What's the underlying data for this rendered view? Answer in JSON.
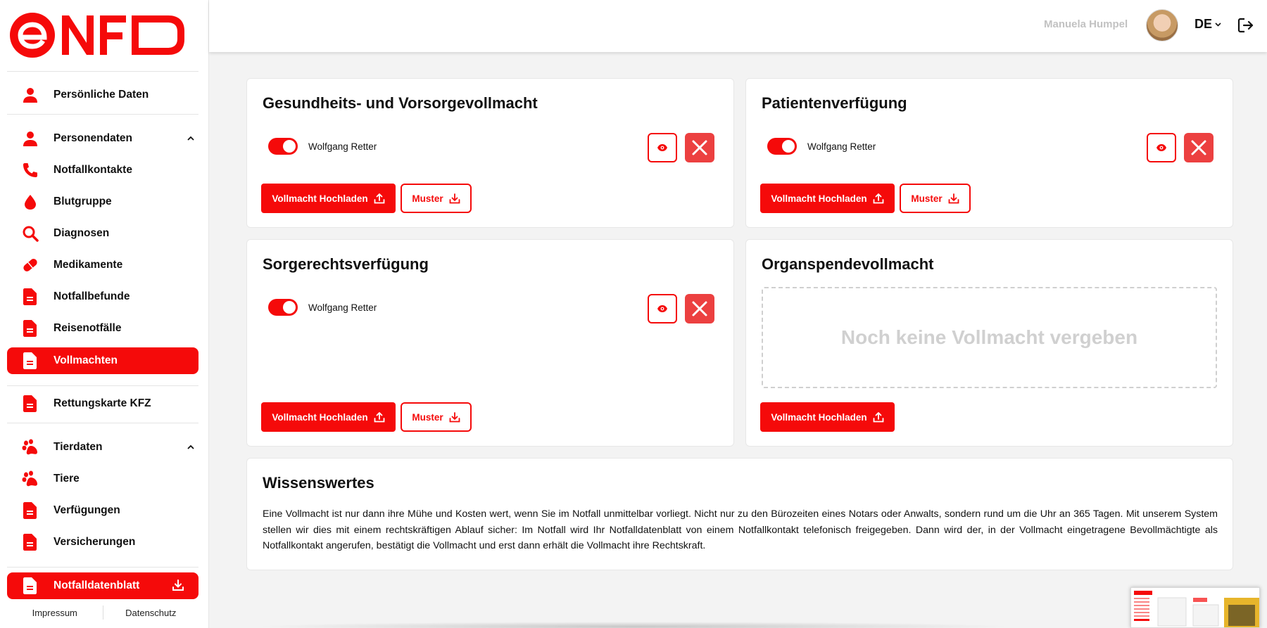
{
  "brand": {
    "logo_text": "eNFD",
    "accent": "#f50a0a",
    "danger": "#ec4040"
  },
  "sidebar": {
    "items": [
      {
        "label": "Persönliche Daten",
        "icon": "person-icon"
      },
      {
        "label": "Personendaten",
        "icon": "person-icon",
        "expanded": true
      },
      {
        "label": "Notfallkontakte",
        "icon": "phone-icon"
      },
      {
        "label": "Blutgruppe",
        "icon": "blood-drop-icon"
      },
      {
        "label": "Diagnosen",
        "icon": "search-icon"
      },
      {
        "label": "Medikamente",
        "icon": "pill-icon"
      },
      {
        "label": "Notfallbefunde",
        "icon": "document-icon"
      },
      {
        "label": "Reisenotfälle",
        "icon": "document-icon"
      },
      {
        "label": "Vollmachten",
        "icon": "document-icon",
        "active": true
      },
      {
        "label": "Rettungskarte KFZ",
        "icon": "document-icon"
      },
      {
        "label": "Tierdaten",
        "icon": "paw-icon",
        "expanded": true
      },
      {
        "label": "Tiere",
        "icon": "paw-icon"
      },
      {
        "label": "Verfügungen",
        "icon": "document-icon"
      },
      {
        "label": "Versicherungen",
        "icon": "document-icon"
      },
      {
        "label": "Notfalldatenblatt",
        "icon": "document-icon",
        "active": true,
        "trailing_icon": "download-icon"
      }
    ],
    "footer": {
      "impressum": "Impressum",
      "datenschutz": "Datenschutz"
    }
  },
  "header": {
    "user_name": "Manuela Humpel",
    "language": "DE"
  },
  "cards": [
    {
      "title": "Gesundheits- und Vorsorgevollmacht",
      "person": "Wolfgang Retter",
      "toggle_on": true,
      "upload_label": "Vollmacht Hochladen",
      "muster_label": "Muster"
    },
    {
      "title": "Patientenverfügung",
      "person": "Wolfgang Retter",
      "toggle_on": true,
      "upload_label": "Vollmacht Hochladen",
      "muster_label": "Muster"
    },
    {
      "title": "Sorgerechtsverfügung",
      "person": "Wolfgang Retter",
      "toggle_on": true,
      "upload_label": "Vollmacht Hochladen",
      "muster_label": "Muster"
    },
    {
      "title": "Organspendevollmacht",
      "empty_text": "Noch keine Vollmacht vergeben",
      "upload_label": "Vollmacht Hochladen"
    }
  ],
  "info": {
    "title": "Wissenswertes",
    "text": "Eine Vollmacht ist nur dann ihre Mühe und Kosten wert, wenn Sie im Notfall unmittelbar vorliegt. Nicht nur zu den Bürozeiten eines Notars oder Anwalts, sondern rund um die Uhr an 365 Tagen. Mit unserem System stellen wir dies mit einem rechtskräftigen Ablauf sicher: Im Notfall wird Ihr Notfalldatenblatt von einem Notfallkontakt telefonisch freigegeben. Dann wird der, in der Vollmacht eingetragene Bevollmächtigte als Notfallkontakt angerufen, bestätigt die Vollmacht und erst dann erhält die Vollmacht ihre Rechtskraft."
  }
}
